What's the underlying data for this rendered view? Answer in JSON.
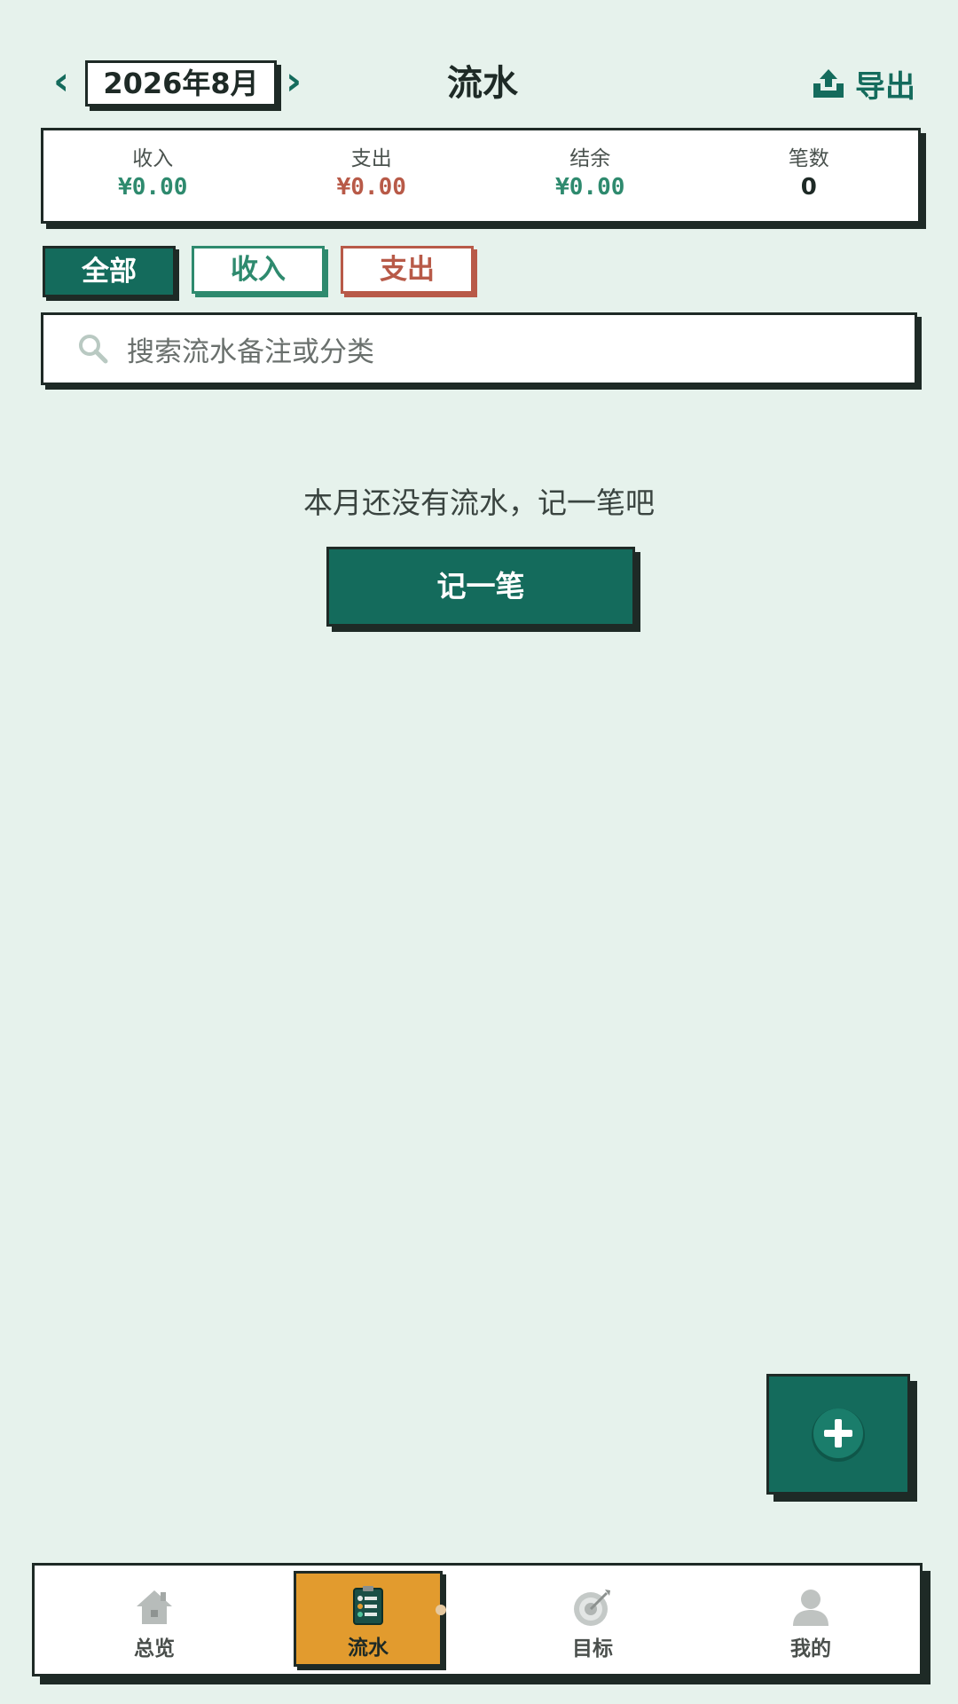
{
  "header": {
    "month": "2026年8月",
    "prev_arrow": "‹",
    "next_arrow": "›",
    "title": "流水",
    "export_label": "导出"
  },
  "summary": {
    "income": {
      "label": "收入",
      "value": "¥0.00",
      "color": "#2e8a6e"
    },
    "expense": {
      "label": "支出",
      "value": "¥0.00",
      "color": "#b85a48"
    },
    "balance": {
      "label": "结余",
      "value": "¥0.00",
      "color": "#2e8a6e"
    },
    "count": {
      "label": "笔数",
      "value": "0",
      "color": "#1e2a26"
    }
  },
  "filters": {
    "all": "全部",
    "income": "收入",
    "expense": "支出",
    "active": "all"
  },
  "search": {
    "placeholder": "搜索流水备注或分类"
  },
  "empty_state": {
    "message": "本月还没有流水，记一笔吧",
    "button_label": "记一笔"
  },
  "fab": {
    "icon": "plus-icon"
  },
  "bottom_nav": {
    "items": [
      {
        "label": "总览",
        "icon": "home-icon"
      },
      {
        "label": "流水",
        "icon": "list-icon",
        "active": true
      },
      {
        "label": "目标",
        "icon": "target-icon"
      },
      {
        "label": "我的",
        "icon": "user-icon"
      }
    ]
  },
  "colors": {
    "background": "#e6f2ec",
    "primary": "#146b5c",
    "income": "#2e8a6e",
    "expense": "#b85a48",
    "active_nav": "#e29b2e",
    "border": "#1e2a26"
  }
}
